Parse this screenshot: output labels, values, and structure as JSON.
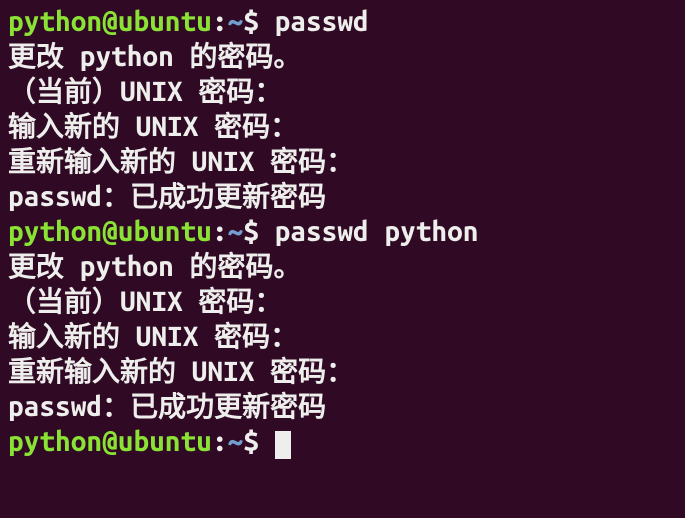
{
  "prompt": {
    "user_host": "python@ubuntu",
    "colon": ":",
    "path": "~",
    "symbol": "$"
  },
  "block1": {
    "command": "passwd",
    "out1": "更改 python 的密码。",
    "out2": "（当前）UNIX 密码：",
    "out3": "输入新的 UNIX 密码：",
    "out4": "重新输入新的 UNIX 密码：",
    "out5": "passwd：已成功更新密码"
  },
  "block2": {
    "command": "passwd python",
    "out1": "更改 python 的密码。",
    "out2": "（当前）UNIX 密码：",
    "out3": "输入新的 UNIX 密码：",
    "out4": "重新输入新的 UNIX 密码：",
    "out5": "passwd：已成功更新密码"
  }
}
